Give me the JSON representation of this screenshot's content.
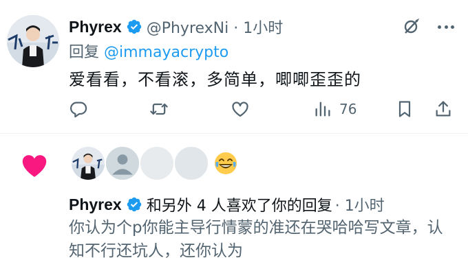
{
  "tweet": {
    "author_name": "Phyrex",
    "handle_time": "@PhyrexNi · 1小时",
    "reply_prefix": "回复",
    "reply_mention": "@immayacrypto",
    "text": "爱看看，不看滚，多简单，唧唧歪歪的",
    "views_count": "76"
  },
  "notification": {
    "author_name": "Phyrex",
    "action_text": "和另外 4 人喜欢了你的回复",
    "time": "· 1小时",
    "reply_text": "你认为个p你能主导行情蒙的准还在哭哈哈写文章，认知不行还坑人，还你认为"
  },
  "colors": {
    "verified": "#1d9bf0",
    "like_heart": "#f91880",
    "mention": "#1d9bf0",
    "secondary_text": "#536471"
  },
  "icons": [
    "verified-badge-icon",
    "grok-icon",
    "more-icon",
    "reply-icon",
    "retweet-icon",
    "like-icon",
    "views-icon",
    "bookmark-icon",
    "share-icon",
    "heart-filled-icon",
    "laughing-emoji-icon",
    "default-avatar-icon"
  ]
}
